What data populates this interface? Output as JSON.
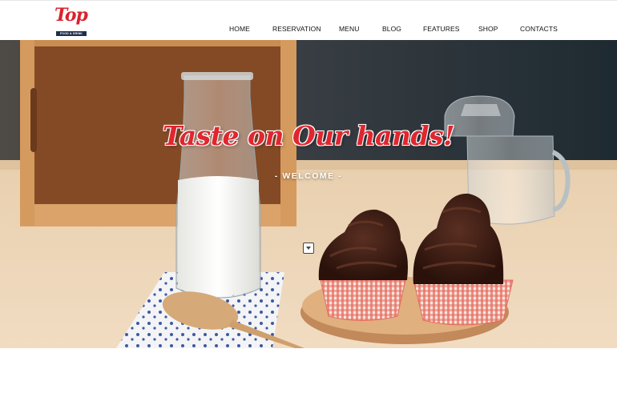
{
  "logo": {
    "script_text": "Top",
    "tagline": "FOOD & DRINK"
  },
  "nav": {
    "items": [
      "HOME",
      "RESERVATION",
      "MENU",
      "BLOG",
      "FEATURES",
      "SHOP",
      "CONTACTS"
    ]
  },
  "hero": {
    "title": "Taste on Our hands!",
    "subtitle": "- WELCOME -"
  },
  "colors": {
    "accent": "#e0262f",
    "logo_red": "#d9232e",
    "logo_tag_bg": "#1f2f4a",
    "nav_text": "#111111"
  },
  "icons": {
    "scroll_down": "chevron-down-icon"
  }
}
